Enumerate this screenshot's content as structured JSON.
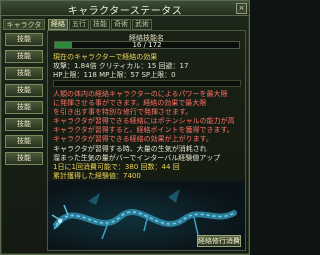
{
  "window": {
    "title": "キャラクターステータス",
    "close_label": "×"
  },
  "sidebar": {
    "header": "キャラクター",
    "items": [
      "技能",
      "技能",
      "技能",
      "技能",
      "技能",
      "技能",
      "技能",
      "技能"
    ]
  },
  "tabs": [
    "経絡",
    "五行",
    "技能",
    "奇術",
    "武術"
  ],
  "panel": {
    "name": "経絡技能名",
    "exp": {
      "text": "16 / 172",
      "fraction": 0.09
    },
    "lines": [
      {
        "text": "現在のキャラクターで経絡の効果",
        "color": "yellow"
      },
      {
        "text": "攻撃：1.84倍 クリティカル：15 回避：17",
        "color": "white"
      },
      {
        "text": "HP上限：118 MP上限：57 SP上限：0",
        "color": "white"
      },
      {
        "text": "人類の体内の経絡キャラクターのによるパワーを最大限",
        "color": "red"
      },
      {
        "text": "に発揮させる事ができます。経絡の効果で最大限",
        "color": "red"
      },
      {
        "text": "を引き出す事を特別な修行で発揮させます。",
        "color": "red"
      },
      {
        "text": "キャラクタが習得できる経絡にはポテンシャルの能力が高",
        "color": "red"
      },
      {
        "text": "キャラクタが習得すると、経絡ポイントを獲得できます。",
        "color": "red"
      },
      {
        "text": "キャラクタが習得できる経絡の効果が上がります。",
        "color": "red"
      },
      {
        "text": "キャラクタが習得する時、大量の生気が消耗され",
        "color": "white"
      },
      {
        "text": "溜まった生気の量がバーでインターバル経験値アップ",
        "color": "white"
      },
      {
        "text": "1日に1回消費可能で：380 回数：44 回",
        "color": "yellow"
      },
      {
        "text": "累計獲得した経験値：7400",
        "color": "yellow"
      }
    ],
    "action_button": "経絡修行消費"
  },
  "colors": {
    "yellow": "#f0d45a",
    "red": "#ff6f66",
    "white": "#e8e4cf",
    "exp_fill": "#2f8a3c"
  }
}
